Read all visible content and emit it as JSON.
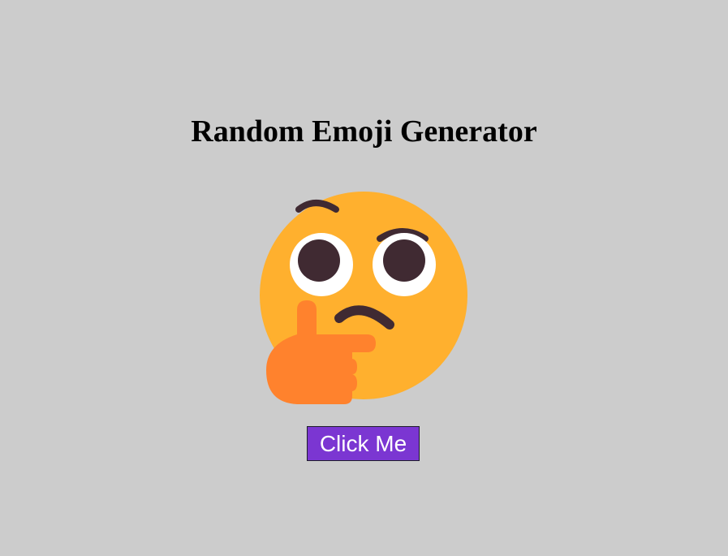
{
  "page": {
    "title": "Random Emoji Generator",
    "background_color": "#cccccc"
  },
  "emoji": {
    "icon": "thinking-face-icon",
    "face_color": "#ffb02e",
    "hand_color": "#ff822d",
    "feature_color": "#402a32"
  },
  "button": {
    "label": "Click Me",
    "background_color": "#7b36d2",
    "text_color": "#ffffff"
  }
}
